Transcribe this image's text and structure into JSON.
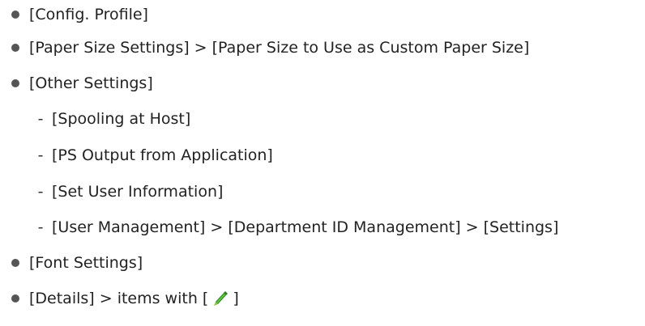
{
  "items": [
    {
      "text": "[Config. Profile]"
    },
    {
      "text": "[Paper Size Settings] > [Paper Size to Use as Custom Paper Size]"
    },
    {
      "text": "[Other Settings]",
      "subitems": [
        {
          "text": "[Spooling at Host]"
        },
        {
          "text": "[PS Output from Application]"
        },
        {
          "text": "[Set User Information]"
        },
        {
          "text": "[User Management] > [Department ID Management] > [Settings]"
        }
      ]
    },
    {
      "text": "[Font Settings]"
    },
    {
      "text_before": "[Details] > items with [",
      "icon": "pencil-icon",
      "text_after": "]"
    }
  ],
  "sub_marker": "-"
}
